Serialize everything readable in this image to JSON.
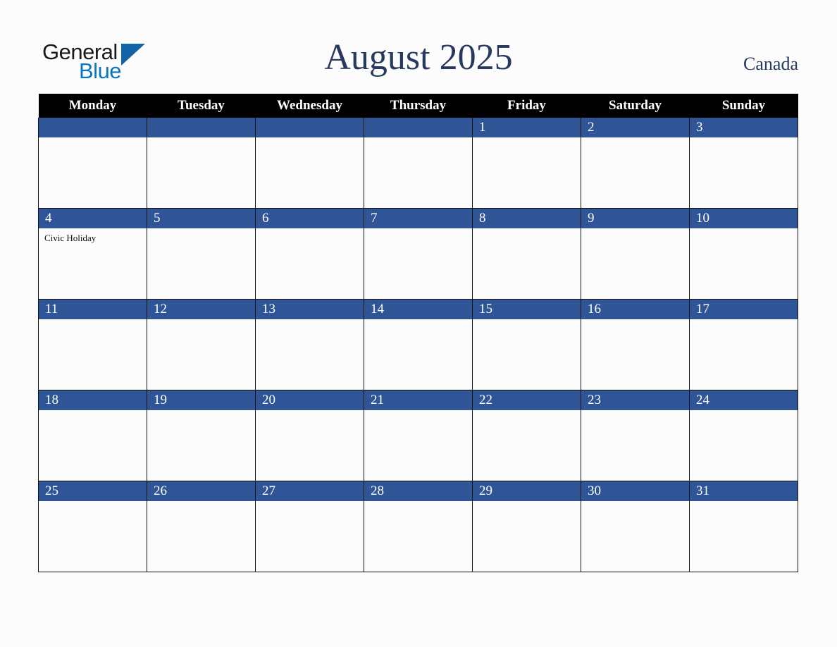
{
  "brand": {
    "name_part1": "General",
    "name_part2": "Blue",
    "primary_color": "#1464a5",
    "accent_color": "#0b76bd"
  },
  "header": {
    "title": "August 2025",
    "region": "Canada"
  },
  "theme": {
    "day_bar_color": "#2f5597",
    "header_row_color": "#000000",
    "title_color": "#29395e",
    "page_background": "#fcfcfc"
  },
  "calendar": {
    "weekday_headers": [
      "Monday",
      "Tuesday",
      "Wednesday",
      "Thursday",
      "Friday",
      "Saturday",
      "Sunday"
    ],
    "weeks": [
      [
        {
          "date": "",
          "events": []
        },
        {
          "date": "",
          "events": []
        },
        {
          "date": "",
          "events": []
        },
        {
          "date": "",
          "events": []
        },
        {
          "date": "1",
          "events": []
        },
        {
          "date": "2",
          "events": []
        },
        {
          "date": "3",
          "events": []
        }
      ],
      [
        {
          "date": "4",
          "events": [
            "Civic Holiday"
          ]
        },
        {
          "date": "5",
          "events": []
        },
        {
          "date": "6",
          "events": []
        },
        {
          "date": "7",
          "events": []
        },
        {
          "date": "8",
          "events": []
        },
        {
          "date": "9",
          "events": []
        },
        {
          "date": "10",
          "events": []
        }
      ],
      [
        {
          "date": "11",
          "events": []
        },
        {
          "date": "12",
          "events": []
        },
        {
          "date": "13",
          "events": []
        },
        {
          "date": "14",
          "events": []
        },
        {
          "date": "15",
          "events": []
        },
        {
          "date": "16",
          "events": []
        },
        {
          "date": "17",
          "events": []
        }
      ],
      [
        {
          "date": "18",
          "events": []
        },
        {
          "date": "19",
          "events": []
        },
        {
          "date": "20",
          "events": []
        },
        {
          "date": "21",
          "events": []
        },
        {
          "date": "22",
          "events": []
        },
        {
          "date": "23",
          "events": []
        },
        {
          "date": "24",
          "events": []
        }
      ],
      [
        {
          "date": "25",
          "events": []
        },
        {
          "date": "26",
          "events": []
        },
        {
          "date": "27",
          "events": []
        },
        {
          "date": "28",
          "events": []
        },
        {
          "date": "29",
          "events": []
        },
        {
          "date": "30",
          "events": []
        },
        {
          "date": "31",
          "events": []
        }
      ]
    ]
  }
}
